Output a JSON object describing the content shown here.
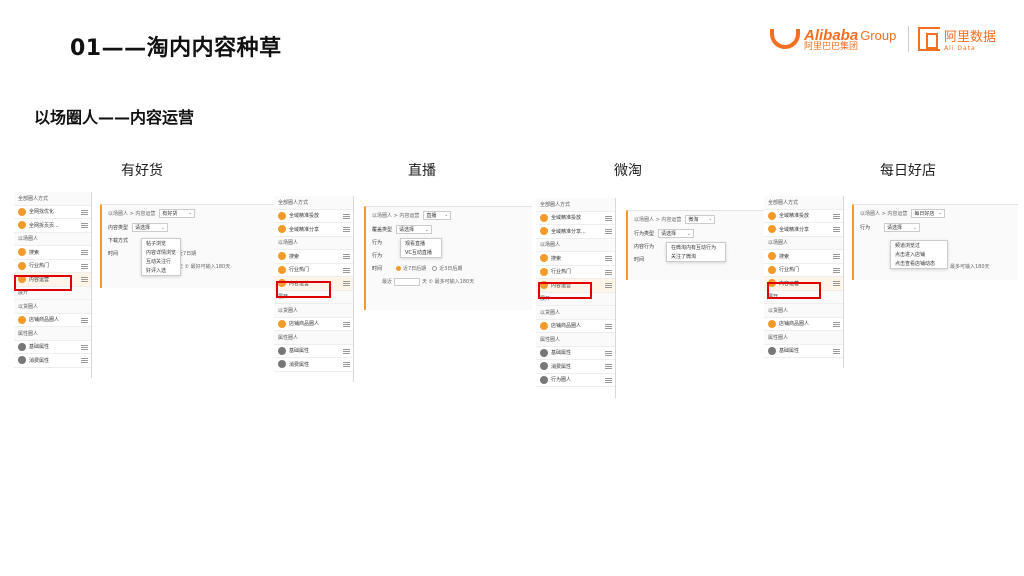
{
  "header": {
    "title": "01——淘内内容种草",
    "subtitle": "以场圈人——内容运营",
    "alibaba_brand": "Alibaba",
    "alibaba_group": "Group",
    "alibaba_cn": "阿里巴巴集团",
    "datashop_cn": "阿里数据",
    "datashop_en": "Ali Data"
  },
  "columns": [
    {
      "label": "有好货"
    },
    {
      "label": "直播"
    },
    {
      "label": "微淘"
    },
    {
      "label": "每日好店"
    }
  ],
  "screens": {
    "s1": {
      "sidebar": [
        {
          "label": "全部圈人方式",
          "type": "head"
        },
        {
          "label": "全网找优化",
          "icon": "orange"
        },
        {
          "label": "全网拆页页...",
          "icon": "orange"
        },
        {
          "label": "以场圈人",
          "type": "head"
        },
        {
          "label": "搜索",
          "icon": "orange"
        },
        {
          "label": "行业热门",
          "icon": "orange"
        },
        {
          "label": "内容运营",
          "icon": "orange",
          "active": true
        },
        {
          "label": "展开",
          "type": "head"
        },
        {
          "label": "以货圈人",
          "type": "head"
        },
        {
          "label": "店铺商品圈人",
          "icon": "orange"
        },
        {
          "label": "属性圈人",
          "type": "head"
        },
        {
          "label": "基础属性",
          "icon": "grey"
        },
        {
          "label": "消费属性",
          "icon": "grey"
        }
      ],
      "breadcrumb": "以场圈人 > 内容运营",
      "crumb_select": "有好货",
      "rows": [
        {
          "label": "内容类型",
          "value": "请选择"
        },
        {
          "label": "下载方式",
          "value": ""
        },
        {
          "label": "时间",
          "value": ""
        }
      ],
      "dropdown": [
        "帖子浏览",
        "内容详情浏览",
        "互动关注行",
        "好评入选"
      ],
      "date_text": "近7日期",
      "note_text": "天  ① 最好可输入180天"
    },
    "s2": {
      "sidebar": [
        {
          "label": "全部圈人方式",
          "type": "head"
        },
        {
          "label": "全域精准投放",
          "icon": "orange"
        },
        {
          "label": "全域精准分享",
          "icon": "orange"
        },
        {
          "label": "以场圈人",
          "type": "head"
        },
        {
          "label": "搜索",
          "icon": "orange"
        },
        {
          "label": "行业热门",
          "icon": "orange"
        },
        {
          "label": "内容运营",
          "icon": "orange",
          "active": true
        },
        {
          "label": "展开",
          "type": "head"
        },
        {
          "label": "以货圈人",
          "type": "head"
        },
        {
          "label": "店铺商品圈人",
          "icon": "orange"
        },
        {
          "label": "属性圈人",
          "type": "head"
        },
        {
          "label": "基础属性",
          "icon": "grey"
        },
        {
          "label": "消费属性",
          "icon": "grey"
        }
      ],
      "breadcrumb": "以场圈人 > 内容运营",
      "crumb_select": "直播",
      "rows": [
        {
          "label": "覆盖类型",
          "value": "请选择"
        },
        {
          "label": "行为",
          "value": ""
        },
        {
          "label": "行为",
          "value": ""
        },
        {
          "label": "时间",
          "value": ""
        }
      ],
      "dropdown": [
        "观看直播",
        "VC互动直播"
      ],
      "radio_a": "近7日后期",
      "radio_b": "近3日后期",
      "recent_label": "最近",
      "day_text": "天  ① 最多可输入180天"
    },
    "s3": {
      "sidebar": [
        {
          "label": "全部圈人方式",
          "type": "head"
        },
        {
          "label": "全域精准投放",
          "icon": "orange"
        },
        {
          "label": "全域精准分享...",
          "icon": "orange"
        },
        {
          "label": "以场圈人",
          "type": "head"
        },
        {
          "label": "搜索",
          "icon": "orange"
        },
        {
          "label": "行业热门",
          "icon": "orange"
        },
        {
          "label": "内容运营",
          "icon": "orange",
          "active": true
        },
        {
          "label": "展开",
          "type": "head"
        },
        {
          "label": "以货圈人",
          "type": "head"
        },
        {
          "label": "店铺商品圈人",
          "icon": "orange"
        },
        {
          "label": "属性圈人",
          "type": "head"
        },
        {
          "label": "基础属性",
          "icon": "grey"
        },
        {
          "label": "消费属性",
          "icon": "grey"
        },
        {
          "label": "行为圈人",
          "icon": "grey"
        }
      ],
      "breadcrumb": "以场圈人 > 内容运营",
      "crumb_select": "微淘",
      "rows": [
        {
          "label": "行为类型",
          "value": "请选择"
        },
        {
          "label": "内容行为",
          "value": ""
        },
        {
          "label": "时间",
          "value": ""
        }
      ],
      "dropdown": [
        "在微淘内有互动行为",
        "关注了微淘"
      ]
    },
    "s4": {
      "sidebar": [
        {
          "label": "全部圈人方式",
          "type": "head"
        },
        {
          "label": "全域精准投放",
          "icon": "orange"
        },
        {
          "label": "全域精准分享",
          "icon": "orange"
        },
        {
          "label": "以场圈人",
          "type": "head"
        },
        {
          "label": "搜索",
          "icon": "orange"
        },
        {
          "label": "行业热门",
          "icon": "orange"
        },
        {
          "label": "内容运营",
          "icon": "orange",
          "active": true
        },
        {
          "label": "展开",
          "type": "head"
        },
        {
          "label": "以货圈人",
          "type": "head"
        },
        {
          "label": "店铺商品圈人",
          "icon": "orange"
        },
        {
          "label": "属性圈人",
          "type": "head"
        },
        {
          "label": "基础属性",
          "icon": "grey"
        }
      ],
      "breadcrumb": "以场圈人 > 内容运营",
      "crumb_select": "每日好店",
      "rows": [
        {
          "label": "行为",
          "value": "请选择"
        }
      ],
      "dropdown": [
        "频道浏览过",
        "点击进入店铺",
        "点击查看店铺动态"
      ],
      "note_text": "最多可输入180天"
    }
  }
}
